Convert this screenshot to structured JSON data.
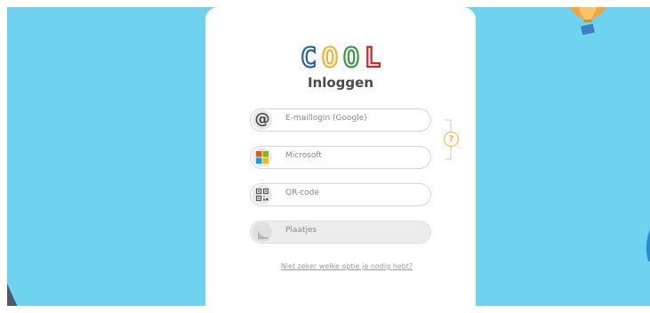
{
  "logo": {
    "text": "COOL",
    "letter_colors": [
      "#2b5fa8",
      "#f2b233",
      "#3a9a45",
      "#d2232a"
    ]
  },
  "page": {
    "title": "Inloggen"
  },
  "login_options": [
    {
      "label": "E-maillogin (Google)",
      "icon": "at-icon"
    },
    {
      "label": "Microsoft",
      "icon": "microsoft-logo-icon"
    },
    {
      "label": "QR-code",
      "icon": "qr-code-icon"
    },
    {
      "label": "Plaatjes",
      "icon": "picture-icon",
      "disabled": true
    }
  ],
  "help": {
    "icon_glyph": "?",
    "link_text": "Niet zeker welke optie je nodig hebt?"
  },
  "colors": {
    "sky": "#6dd3ee",
    "accent": "#f2b233",
    "balloon": "#f7a23b"
  }
}
